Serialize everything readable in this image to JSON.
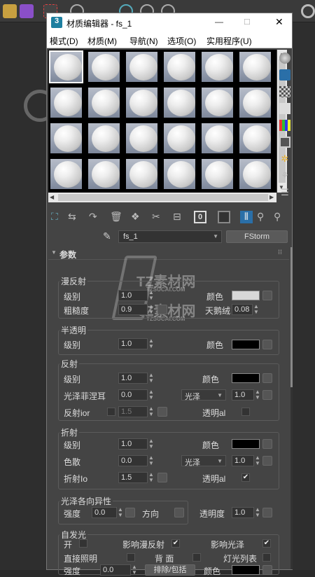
{
  "window": {
    "title": "材质编辑器 - fs_1",
    "minimize": "—",
    "maximize": "□",
    "close": "✕"
  },
  "menu": [
    "模式(D)",
    "材质(M)",
    "导航(N)",
    "选项(O)",
    "实用程序(U)"
  ],
  "material_name": "fs_1",
  "material_type": "FStorm",
  "rollout_title": "参数",
  "diffuse": {
    "title": "漫反射",
    "level_label": "级别",
    "level": "1.0",
    "roughness_label": "粗糙度",
    "roughness": "0.9",
    "color_label": "颜色",
    "color": "#d8d8d8",
    "velvet_label": "天鹅绒",
    "velvet": "0.08"
  },
  "translucency": {
    "title": "半透明",
    "level_label": "级别",
    "level": "1.0",
    "color_label": "颜色",
    "color": "#000000"
  },
  "reflection": {
    "title": "反射",
    "level_label": "级别",
    "level": "1.0",
    "color_label": "颜色",
    "color": "#000000",
    "fresnel_label": "光泽菲涅耳",
    "fresnel": "0.0",
    "gloss_mode": "光泽",
    "gloss": "1.0",
    "ior_label": "反射ior",
    "ior": "1.5",
    "transparent_label": "透明al"
  },
  "refraction": {
    "title": "折射",
    "level_label": "级别",
    "level": "1.0",
    "color_label": "颜色",
    "color": "#000000",
    "dispersion_label": "色散",
    "dispersion": "0.0",
    "gloss_mode": "光泽",
    "gloss": "1.0",
    "ior_label": "折射Io",
    "ior": "1.5",
    "transparent_label": "透明al"
  },
  "anisotropy": {
    "title": "光泽各向异性",
    "strength_label": "强度",
    "strength": "0.0",
    "direction_label": "方向",
    "opacity_label": "透明度",
    "opacity": "1.0"
  },
  "emission": {
    "title": "自发光",
    "on_label": "开",
    "affect_diffuse_label": "影响漫反射",
    "affect_gloss_label": "影响光泽",
    "direct_label": "直接照明",
    "back_label": "背 面",
    "light_list_label": "灯光列表",
    "strength_label": "强度",
    "strength": "0.0",
    "exclude_label": "排除/包括",
    "color_label": "颜色",
    "color": "#000000"
  },
  "watermark": {
    "text": "TZ素材网",
    "sub": "TZSUCAI.COM"
  }
}
